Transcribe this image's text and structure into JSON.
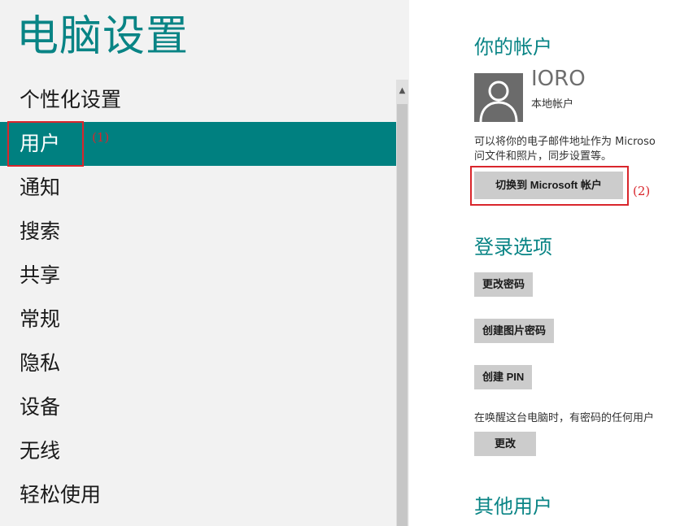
{
  "left_panel": {
    "title": "电脑设置",
    "nav_items": [
      {
        "label": "个性化设置"
      },
      {
        "label": "用户"
      },
      {
        "label": "通知"
      },
      {
        "label": "搜索"
      },
      {
        "label": "共享"
      },
      {
        "label": "常规"
      },
      {
        "label": "隐私"
      },
      {
        "label": "设备"
      },
      {
        "label": "无线"
      },
      {
        "label": "轻松使用"
      }
    ],
    "selected_item": "用户",
    "scroll_up_icon": "▲"
  },
  "account_section": {
    "heading": "你的帐户",
    "user_name": "IORO",
    "account_type": "本地帐户",
    "description_line1": "可以将你的电子邮件地址作为 Microso",
    "description_line2": "问文件和照片，同步设置等。",
    "switch_button": "切换到 Microsoft 帐户"
  },
  "sign_in_section": {
    "heading": "登录选项",
    "change_password": "更改密码",
    "create_picture_password": "创建图片密码",
    "create_pin": "创建 PIN",
    "wake_text": "在唤醒这台电脑时，有密码的任何用户",
    "change_button": "更改"
  },
  "other_users_section": {
    "heading": "其他用户"
  },
  "annotations": {
    "label_1": "(1)",
    "label_2": "(2)"
  },
  "colors": {
    "accent": "#098485",
    "selected_bg": "#008080",
    "left_bg": "#f2f2f2",
    "button_bg": "#cccccc",
    "annotation_red": "#d9262c"
  },
  "icons": {
    "avatar": "user-silhouette-icon",
    "scroll_up": "chevron-up-icon"
  }
}
